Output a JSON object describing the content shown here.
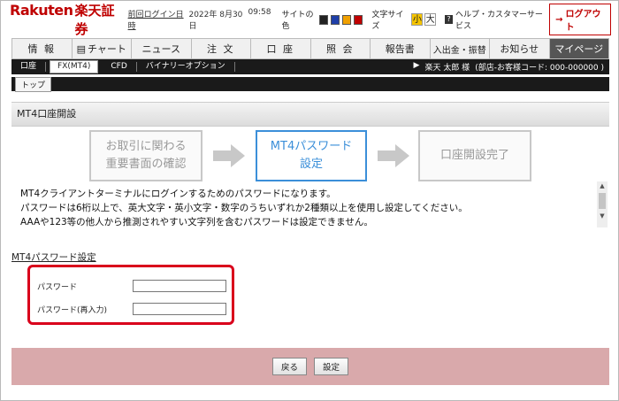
{
  "header": {
    "logo_en": "Rakuten",
    "logo_jp": "楽天証券",
    "last_login_label": "前回ログイン日時",
    "last_login_date": "2022年 8月30日",
    "last_login_time": "09:58",
    "site_color_label": "サイトの色",
    "site_colors": [
      "#222222",
      "#1f3fa8",
      "#f0a000",
      "#c00000"
    ],
    "font_size_label": "文字サイズ",
    "font_small": "小",
    "font_large": "大",
    "help_label": "ヘルプ・カスタマーサービス",
    "logout_label": "ログアウト"
  },
  "main_nav": [
    {
      "label": "情 報"
    },
    {
      "label": "チャート"
    },
    {
      "label": "ニュース"
    },
    {
      "label": "注 文"
    },
    {
      "label": "口 座"
    },
    {
      "label": "照 会"
    },
    {
      "label": "報告書"
    },
    {
      "label": "入出金・振替"
    },
    {
      "label": "お知らせ"
    },
    {
      "label": "マイページ"
    }
  ],
  "sub_nav": {
    "items": [
      {
        "label": "口座"
      },
      {
        "label": "FX(MT4)"
      },
      {
        "label": "CFD"
      },
      {
        "label": "バイナリーオプション"
      }
    ],
    "user_arrow": "▶",
    "user_name": "楽天 太郎 様",
    "account_label": "(部店-お客様コード: 000-000000 )"
  },
  "tab_row": {
    "top_label": "トップ"
  },
  "content": {
    "title": "MT4口座開設",
    "steps": [
      {
        "line1": "お取引に関わる",
        "line2": "重要書面の確認"
      },
      {
        "line1": "MT4パスワード",
        "line2": "設定"
      },
      {
        "line1": "口座開設完了",
        "line2": ""
      }
    ],
    "desc_lines": [
      "MT4クライアントターミナルにログインするためのパスワードになります。",
      "パスワードは6桁以上で、英大文字・英小文字・数字のうちいずれか2種類以上を使用し設定してください。",
      "AAAや123等の他人から推測されやすい文字列を含むパスワードは設定できません。"
    ],
    "section_title": "MT4パスワード設定",
    "password_label": "パスワード",
    "password_value": "",
    "password_confirm_label": "パスワード(再入力)",
    "password_confirm_value": "",
    "back_label": "戻る",
    "submit_label": "設定"
  },
  "colors": {
    "brand_red": "#bf0000",
    "highlight_red": "#d9001b",
    "step_current_blue": "#3b8fd9",
    "footer_pink": "#d9a9ab"
  }
}
